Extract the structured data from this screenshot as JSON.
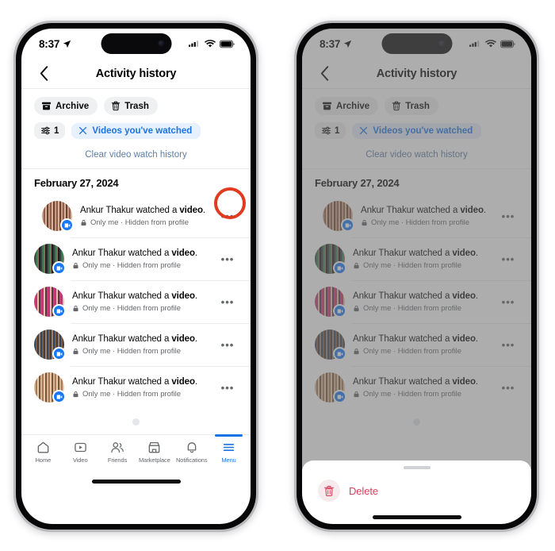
{
  "status_bar": {
    "time": "8:37",
    "location_icon": "location-arrow-icon",
    "signal_icon": "cellular-signal-icon",
    "wifi_icon": "wifi-icon",
    "battery_icon": "battery-full-icon"
  },
  "nav": {
    "back_icon": "chevron-left-icon",
    "title": "Activity history"
  },
  "chips": [
    {
      "label": "Archive",
      "icon": "archive-box-icon"
    },
    {
      "label": "Trash",
      "icon": "trash-can-icon"
    }
  ],
  "filters": {
    "count_icon": "sliders-filter-icon",
    "count": "1",
    "active_filter_label": "Videos you've watched",
    "active_filter_close_icon": "close-x-icon"
  },
  "clear_link": "Clear video watch history",
  "date_header": "February 27, 2024",
  "rows": [
    {
      "title_prefix": "Ankur Thakur watched a ",
      "title_bold": "video",
      "title_suffix": ".",
      "privacy_icon": "lock-icon",
      "meta": "Only me · Hidden from profile",
      "more_icon": "ellipsis-horizontal-icon",
      "badge_icon": "video-badge-icon",
      "thumb_colors": [
        "#c89a84",
        "#8e5f4a",
        "#d8b49b",
        "#6a4130",
        "#e0c3ad"
      ]
    },
    {
      "title_prefix": "Ankur Thakur watched a ",
      "title_bold": "video",
      "title_suffix": ".",
      "privacy_icon": "lock-icon",
      "meta": "Only me · Hidden from profile",
      "more_icon": "ellipsis-horizontal-icon",
      "badge_icon": "video-badge-icon",
      "thumb_colors": [
        "#3b3b40",
        "#2e7d4f",
        "#8a6c5a",
        "#1d1d22",
        "#b08d74"
      ]
    },
    {
      "title_prefix": "Ankur Thakur watched a ",
      "title_bold": "video",
      "title_suffix": ".",
      "privacy_icon": "lock-icon",
      "meta": "Only me · Hidden from profile",
      "more_icon": "ellipsis-horizontal-icon",
      "badge_icon": "video-badge-icon",
      "thumb_colors": [
        "#d9337a",
        "#9b4a6b",
        "#e8c0a8",
        "#5a3550",
        "#c26a8f"
      ]
    },
    {
      "title_prefix": "Ankur Thakur watched a ",
      "title_bold": "video",
      "title_suffix": ".",
      "privacy_icon": "lock-icon",
      "meta": "Only me · Hidden from profile",
      "more_icon": "ellipsis-horizontal-icon",
      "badge_icon": "video-badge-icon",
      "thumb_colors": [
        "#2f4560",
        "#7a5c48",
        "#3d3d46",
        "#a08060",
        "#575a66"
      ]
    },
    {
      "title_prefix": "Ankur Thakur watched a ",
      "title_bold": "video",
      "title_suffix": ".",
      "privacy_icon": "lock-icon",
      "meta": "Only me · Hidden from profile",
      "more_icon": "ellipsis-horizontal-icon",
      "badge_icon": "video-badge-icon",
      "thumb_colors": [
        "#d8b393",
        "#a87a55",
        "#e3cbb0",
        "#7a5433",
        "#c49a72"
      ]
    }
  ],
  "loading_spinner": "loading-spinner",
  "tabs": [
    {
      "label": "Home",
      "icon": "home-icon",
      "active": false
    },
    {
      "label": "Video",
      "icon": "video-play-icon",
      "active": false
    },
    {
      "label": "Friends",
      "icon": "friends-people-icon",
      "active": false
    },
    {
      "label": "Marketplace",
      "icon": "marketplace-storefront-icon",
      "active": false
    },
    {
      "label": "Notifications",
      "icon": "bell-icon",
      "active": false
    },
    {
      "label": "Menu",
      "icon": "hamburger-menu-icon",
      "active": true
    }
  ],
  "action_sheet": {
    "handle": "sheet-grab-handle",
    "delete_label": "Delete",
    "delete_icon": "trash-can-icon"
  },
  "annotation": {
    "highlight_icon": "red-circle-highlight"
  },
  "colors": {
    "accent_blue": "#1b74e4",
    "link_blue": "#5c7fa6",
    "delete_red": "#d9415c",
    "annotation_red": "#e03b1e",
    "chip_gray": "#eff0f2",
    "meta_gray": "#65676b"
  }
}
